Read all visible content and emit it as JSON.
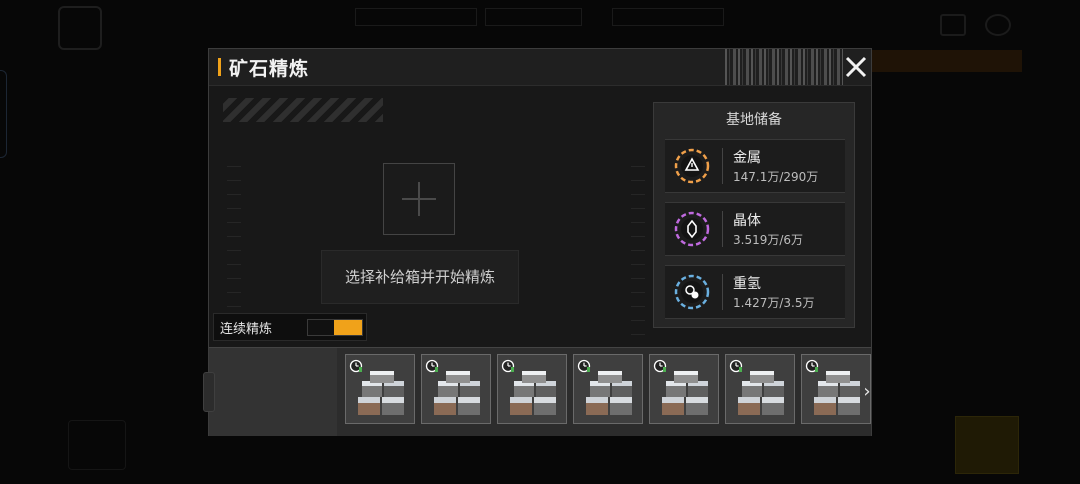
{
  "panel": {
    "title": "矿石精炼",
    "close_icon": "close-icon"
  },
  "refine": {
    "start_label": "选择补给箱并开始精炼",
    "continuous_label": "连续精炼",
    "continuous_on": true,
    "accent_color": "#f0a21a"
  },
  "storage": {
    "title": "基地储备",
    "resources": [
      {
        "name": "金属",
        "value": "147.1万/290万",
        "icon": "warning-triangle-icon",
        "color": "#f0a04a"
      },
      {
        "name": "晶体",
        "value": "3.519万/6万",
        "icon": "crystal-icon",
        "color": "#c06adf"
      },
      {
        "name": "重氢",
        "value": "1.427万/3.5万",
        "icon": "deuterium-icon",
        "color": "#6ab0e0"
      }
    ]
  },
  "tray": {
    "items": [
      {
        "name": "supply-box"
      },
      {
        "name": "supply-box"
      },
      {
        "name": "supply-box"
      },
      {
        "name": "supply-box"
      },
      {
        "name": "supply-box"
      },
      {
        "name": "supply-box"
      },
      {
        "name": "supply-box"
      }
    ],
    "next_label": "›"
  }
}
